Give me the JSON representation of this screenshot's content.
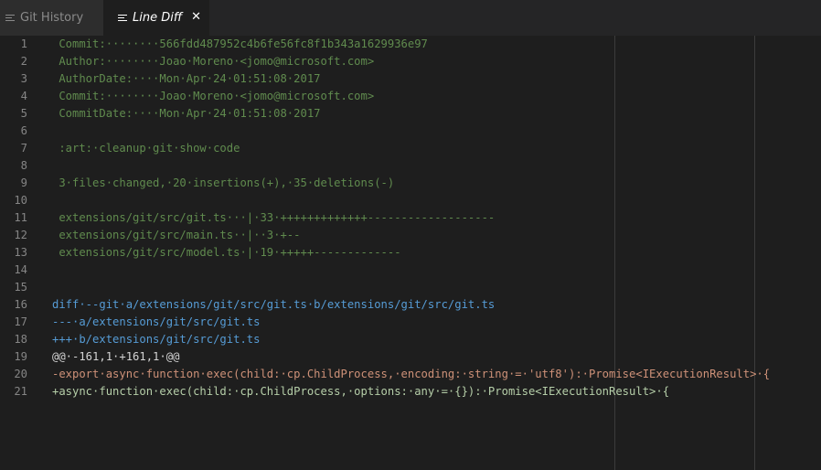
{
  "tabs": [
    {
      "label": "Git History",
      "icon": "lines-icon"
    },
    {
      "label": "Line Diff",
      "icon": "lines-icon",
      "close": "✕"
    }
  ],
  "editor": {
    "lines": [
      {
        "n": "1",
        "text": " Commit:········566fdd487952c4b6fe56fc8f1b343a1629936e97",
        "kind": "comment"
      },
      {
        "n": "2",
        "text": " Author:········Joao·Moreno·<jomo@microsoft.com>",
        "kind": "comment"
      },
      {
        "n": "3",
        "text": " AuthorDate:····Mon·Apr·24·01:51:08·2017",
        "kind": "comment"
      },
      {
        "n": "4",
        "text": " Commit:········Joao·Moreno·<jomo@microsoft.com>",
        "kind": "comment"
      },
      {
        "n": "5",
        "text": " CommitDate:····Mon·Apr·24·01:51:08·2017",
        "kind": "comment"
      },
      {
        "n": "6",
        "text": "",
        "kind": "comment"
      },
      {
        "n": "7",
        "text": " :art:·cleanup·git·show·code",
        "kind": "comment"
      },
      {
        "n": "8",
        "text": "",
        "kind": "comment"
      },
      {
        "n": "9",
        "text": " 3·files·changed,·20·insertions(+),·35·deletions(-)",
        "kind": "comment"
      },
      {
        "n": "10",
        "text": "",
        "kind": "comment"
      },
      {
        "n": "11",
        "text": " extensions/git/src/git.ts···|·33·+++++++++++++-------------------",
        "kind": "comment"
      },
      {
        "n": "12",
        "text": " extensions/git/src/main.ts··|··3·+--",
        "kind": "comment"
      },
      {
        "n": "13",
        "text": " extensions/git/src/model.ts·|·19·+++++-------------",
        "kind": "comment"
      },
      {
        "n": "14",
        "text": "",
        "kind": "comment"
      },
      {
        "n": "15",
        "text": "",
        "kind": "comment"
      },
      {
        "n": "16",
        "text": "diff·--git·a/extensions/git/src/git.ts·b/extensions/git/src/git.ts",
        "kind": "meta"
      },
      {
        "n": "17",
        "text": "---·a/extensions/git/src/git.ts",
        "kind": "meta"
      },
      {
        "n": "18",
        "text": "+++·b/extensions/git/src/git.ts",
        "kind": "meta"
      },
      {
        "n": "19",
        "text": "@@·-161,1·+161,1·@@",
        "kind": "plain"
      },
      {
        "n": "20",
        "text": "-export·async·function·exec(child:·cp.ChildProcess,·encoding:·string·=·'utf8'):·Promise<IExecutionResult>·{",
        "kind": "del"
      },
      {
        "n": "21",
        "text": "+async·function·exec(child:·cp.ChildProcess,·options:·any·=·{}):·Promise<IExecutionResult>·{",
        "kind": "add"
      }
    ]
  },
  "colors": {
    "comment": "#608b4e",
    "meta": "#569cd6",
    "del": "#ce9178",
    "add": "#b5cea8",
    "plain": "#d4d4d4"
  }
}
